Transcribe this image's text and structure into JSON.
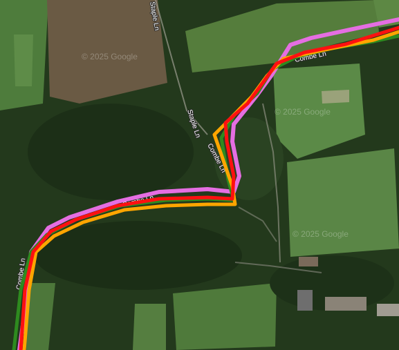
{
  "map": {
    "road_labels": {
      "staple_top": "Staple Ln",
      "staple_mid": "Staple Ln",
      "combe_mid": "Combe Ln",
      "combe_left": "Combe Ln",
      "combe_top": "Combe Ln",
      "combe_bottom": "Combe Ln"
    },
    "watermarks": [
      "© 2025 Google",
      "© 2025 Google",
      "© 2025 Google"
    ],
    "routes": [
      {
        "color": "#e56ee2"
      },
      {
        "color": "#2e8b1f"
      },
      {
        "color": "#ffa500"
      },
      {
        "color": "#ff1010"
      }
    ]
  }
}
